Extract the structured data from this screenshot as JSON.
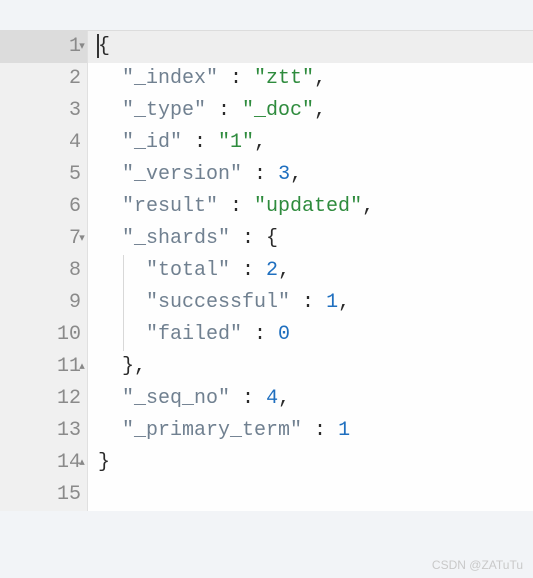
{
  "watermark": "CSDN @ZATuTu",
  "lines": [
    {
      "num": "1",
      "fold": "▾",
      "active": true,
      "guide": false,
      "tokens": [
        {
          "t": "punc",
          "v": "{"
        }
      ],
      "cursor": true
    },
    {
      "num": "2",
      "fold": "",
      "active": false,
      "guide": false,
      "tokens": [
        {
          "t": "pad",
          "v": "  "
        },
        {
          "t": "key",
          "v": "\"_index\""
        },
        {
          "t": "punc",
          "v": " : "
        },
        {
          "t": "str",
          "v": "\"ztt\""
        },
        {
          "t": "punc",
          "v": ","
        }
      ]
    },
    {
      "num": "3",
      "fold": "",
      "active": false,
      "guide": false,
      "tokens": [
        {
          "t": "pad",
          "v": "  "
        },
        {
          "t": "key",
          "v": "\"_type\""
        },
        {
          "t": "punc",
          "v": " : "
        },
        {
          "t": "str",
          "v": "\"_doc\""
        },
        {
          "t": "punc",
          "v": ","
        }
      ]
    },
    {
      "num": "4",
      "fold": "",
      "active": false,
      "guide": false,
      "tokens": [
        {
          "t": "pad",
          "v": "  "
        },
        {
          "t": "key",
          "v": "\"_id\""
        },
        {
          "t": "punc",
          "v": " : "
        },
        {
          "t": "str",
          "v": "\"1\""
        },
        {
          "t": "punc",
          "v": ","
        }
      ]
    },
    {
      "num": "5",
      "fold": "",
      "active": false,
      "guide": false,
      "tokens": [
        {
          "t": "pad",
          "v": "  "
        },
        {
          "t": "key",
          "v": "\"_version\""
        },
        {
          "t": "punc",
          "v": " : "
        },
        {
          "t": "num",
          "v": "3"
        },
        {
          "t": "punc",
          "v": ","
        }
      ]
    },
    {
      "num": "6",
      "fold": "",
      "active": false,
      "guide": false,
      "tokens": [
        {
          "t": "pad",
          "v": "  "
        },
        {
          "t": "key",
          "v": "\"result\""
        },
        {
          "t": "punc",
          "v": " : "
        },
        {
          "t": "str",
          "v": "\"updated\""
        },
        {
          "t": "punc",
          "v": ","
        }
      ]
    },
    {
      "num": "7",
      "fold": "▾",
      "active": false,
      "guide": false,
      "tokens": [
        {
          "t": "pad",
          "v": "  "
        },
        {
          "t": "key",
          "v": "\"_shards\""
        },
        {
          "t": "punc",
          "v": " : {"
        }
      ]
    },
    {
      "num": "8",
      "fold": "",
      "active": false,
      "guide": true,
      "tokens": [
        {
          "t": "pad",
          "v": "    "
        },
        {
          "t": "key",
          "v": "\"total\""
        },
        {
          "t": "punc",
          "v": " : "
        },
        {
          "t": "num",
          "v": "2"
        },
        {
          "t": "punc",
          "v": ","
        }
      ]
    },
    {
      "num": "9",
      "fold": "",
      "active": false,
      "guide": true,
      "tokens": [
        {
          "t": "pad",
          "v": "    "
        },
        {
          "t": "key",
          "v": "\"successful\""
        },
        {
          "t": "punc",
          "v": " : "
        },
        {
          "t": "num",
          "v": "1"
        },
        {
          "t": "punc",
          "v": ","
        }
      ]
    },
    {
      "num": "10",
      "fold": "",
      "active": false,
      "guide": true,
      "tokens": [
        {
          "t": "pad",
          "v": "    "
        },
        {
          "t": "key",
          "v": "\"failed\""
        },
        {
          "t": "punc",
          "v": " : "
        },
        {
          "t": "num",
          "v": "0"
        }
      ]
    },
    {
      "num": "11",
      "fold": "▴",
      "active": false,
      "guide": false,
      "tokens": [
        {
          "t": "pad",
          "v": "  "
        },
        {
          "t": "punc",
          "v": "},"
        }
      ]
    },
    {
      "num": "12",
      "fold": "",
      "active": false,
      "guide": false,
      "tokens": [
        {
          "t": "pad",
          "v": "  "
        },
        {
          "t": "key",
          "v": "\"_seq_no\""
        },
        {
          "t": "punc",
          "v": " : "
        },
        {
          "t": "num",
          "v": "4"
        },
        {
          "t": "punc",
          "v": ","
        }
      ]
    },
    {
      "num": "13",
      "fold": "",
      "active": false,
      "guide": false,
      "tokens": [
        {
          "t": "pad",
          "v": "  "
        },
        {
          "t": "key",
          "v": "\"_primary_term\""
        },
        {
          "t": "punc",
          "v": " : "
        },
        {
          "t": "num",
          "v": "1"
        }
      ]
    },
    {
      "num": "14",
      "fold": "▴",
      "active": false,
      "guide": false,
      "tokens": [
        {
          "t": "punc",
          "v": "}"
        }
      ]
    },
    {
      "num": "15",
      "fold": "",
      "active": false,
      "guide": false,
      "tokens": []
    }
  ]
}
